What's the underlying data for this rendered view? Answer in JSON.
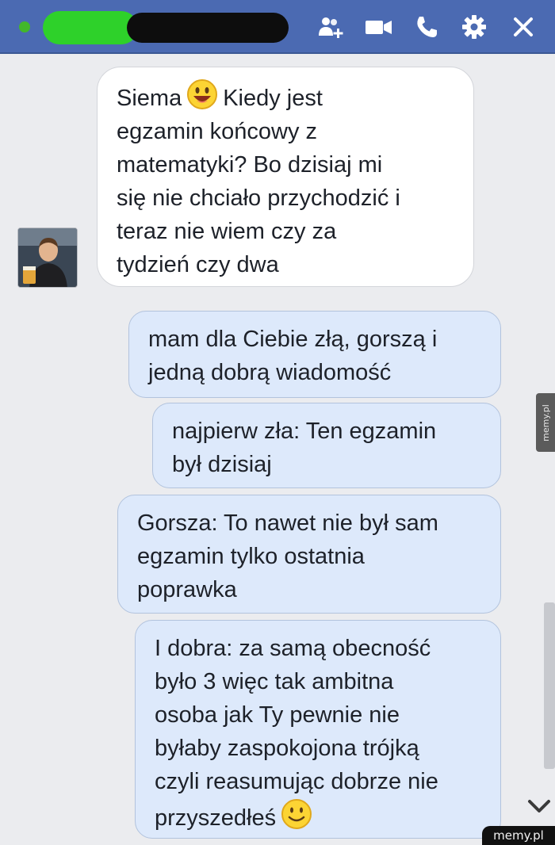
{
  "header": {
    "status": "online",
    "icons": [
      "add-people-icon",
      "video-call-icon",
      "phone-icon",
      "gear-icon",
      "close-icon"
    ],
    "accent_color": "#4b6ab2"
  },
  "messages": {
    "incoming": [
      {
        "lines": [
          "Siema",
          "Kiedy jest",
          "egzamin końcowy z",
          "matematyki? Bo dzisiaj mi",
          "się nie chciało przychodzić i",
          "teraz nie wiem czy za",
          "tydzień czy dwa"
        ]
      }
    ],
    "outgoing": [
      {
        "lines": [
          "mam dla Ciebie złą, gorszą i",
          "jedną dobrą wiadomość"
        ]
      },
      {
        "lines": [
          "najpierw zła: Ten egzamin",
          "był dzisiaj"
        ]
      },
      {
        "lines": [
          "Gorsza: To nawet nie był sam",
          "egzamin tylko ostatnia",
          "poprawka"
        ]
      },
      {
        "lines": [
          "I dobra: za samą obecność",
          "było 3 więc tak ambitna",
          "osoba jak Ty pewnie nie",
          "byłaby zaspokojona trójką",
          "czyli reasumując dobrze nie",
          "przyszedłeś"
        ]
      }
    ]
  },
  "watermark": {
    "side": "memy.pl",
    "bottom": "memy.pl"
  }
}
